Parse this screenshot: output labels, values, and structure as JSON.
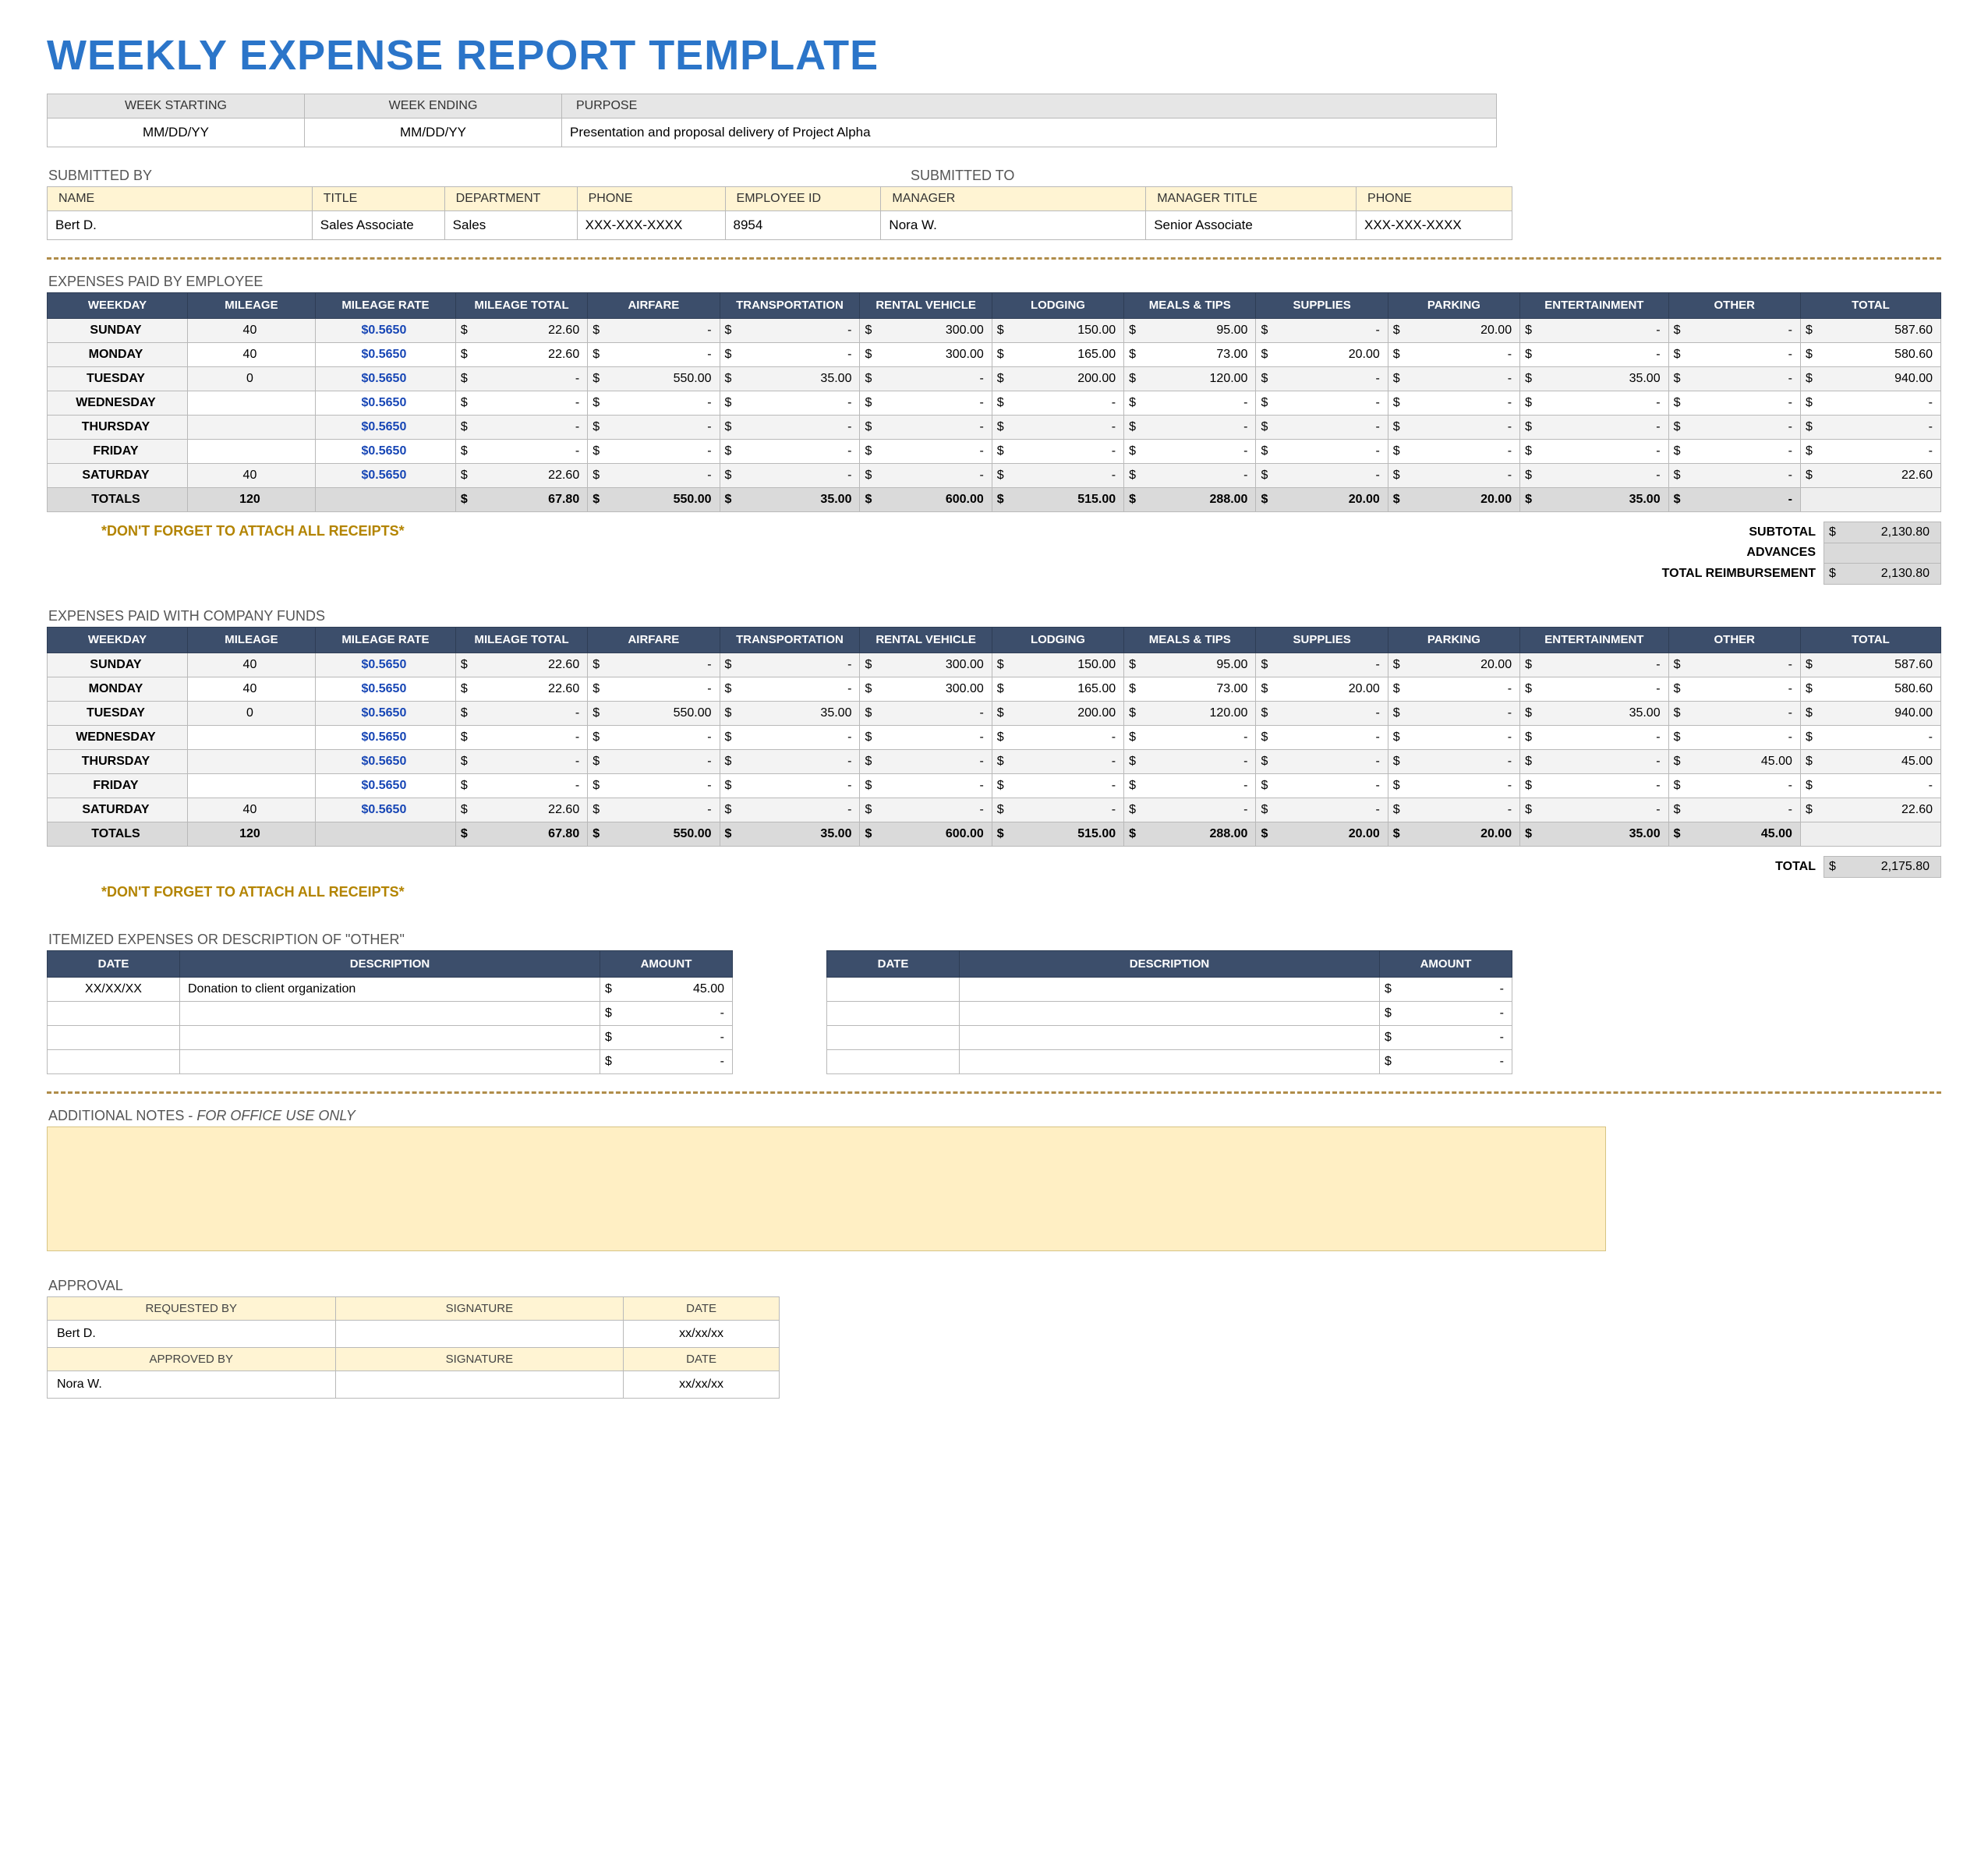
{
  "title": "WEEKLY EXPENSE REPORT TEMPLATE",
  "period": {
    "hdr_start": "WEEK STARTING",
    "hdr_end": "WEEK ENDING",
    "hdr_purpose": "PURPOSE",
    "start": "MM/DD/YY",
    "end": "MM/DD/YY",
    "purpose": "Presentation and proposal delivery of Project Alpha"
  },
  "submit": {
    "by_label": "SUBMITTED BY",
    "to_label": "SUBMITTED TO",
    "hdr_name": "NAME",
    "hdr_title": "TITLE",
    "hdr_dept": "DEPARTMENT",
    "hdr_phone": "PHONE",
    "hdr_emp": "EMPLOYEE ID",
    "hdr_mgr": "MANAGER",
    "hdr_mgt": "MANAGER TITLE",
    "name": "Bert D.",
    "title": "Sales Associate",
    "dept": "Sales",
    "phone": "XXX-XXX-XXXX",
    "emp": "8954",
    "mgr": "Nora W.",
    "mgt": "Senior Associate",
    "mgp": "XXX-XXX-XXXX"
  },
  "exp_hdr": {
    "weekday": "WEEKDAY",
    "mileage": "MILEAGE",
    "rate": "MILEAGE RATE",
    "mtotal": "MILEAGE TOTAL",
    "air": "AIRFARE",
    "trans": "TRANSPORTATION",
    "rental": "RENTAL VEHICLE",
    "lodging": "LODGING",
    "meals": "MEALS & TIPS",
    "supplies": "SUPPLIES",
    "parking": "PARKING",
    "ent": "ENTERTAINMENT",
    "other": "OTHER",
    "total": "TOTAL",
    "totals_lbl": "TOTALS"
  },
  "section_employee": "EXPENSES PAID BY EMPLOYEE",
  "section_company": "EXPENSES PAID WITH COMPANY FUNDS",
  "rate_str": "$0.5650",
  "employee_rows": [
    {
      "day": "SUNDAY",
      "mile": "40",
      "mtot": "22.60",
      "air": "-",
      "trans": "-",
      "rent": "300.00",
      "lod": "150.00",
      "meal": "95.00",
      "sup": "-",
      "park": "20.00",
      "ent": "-",
      "oth": "-",
      "tot": "587.60"
    },
    {
      "day": "MONDAY",
      "mile": "40",
      "mtot": "22.60",
      "air": "-",
      "trans": "-",
      "rent": "300.00",
      "lod": "165.00",
      "meal": "73.00",
      "sup": "20.00",
      "park": "-",
      "ent": "-",
      "oth": "-",
      "tot": "580.60"
    },
    {
      "day": "TUESDAY",
      "mile": "0",
      "mtot": "-",
      "air": "550.00",
      "trans": "35.00",
      "rent": "-",
      "lod": "200.00",
      "meal": "120.00",
      "sup": "-",
      "park": "-",
      "ent": "35.00",
      "oth": "-",
      "tot": "940.00"
    },
    {
      "day": "WEDNESDAY",
      "mile": "",
      "mtot": "-",
      "air": "-",
      "trans": "-",
      "rent": "-",
      "lod": "-",
      "meal": "-",
      "sup": "-",
      "park": "-",
      "ent": "-",
      "oth": "-",
      "tot": "-"
    },
    {
      "day": "THURSDAY",
      "mile": "",
      "mtot": "-",
      "air": "-",
      "trans": "-",
      "rent": "-",
      "lod": "-",
      "meal": "-",
      "sup": "-",
      "park": "-",
      "ent": "-",
      "oth": "-",
      "tot": "-"
    },
    {
      "day": "FRIDAY",
      "mile": "",
      "mtot": "-",
      "air": "-",
      "trans": "-",
      "rent": "-",
      "lod": "-",
      "meal": "-",
      "sup": "-",
      "park": "-",
      "ent": "-",
      "oth": "-",
      "tot": "-"
    },
    {
      "day": "SATURDAY",
      "mile": "40",
      "mtot": "22.60",
      "air": "-",
      "trans": "-",
      "rent": "-",
      "lod": "-",
      "meal": "-",
      "sup": "-",
      "park": "-",
      "ent": "-",
      "oth": "-",
      "tot": "22.60"
    }
  ],
  "employee_totals": {
    "mile": "120",
    "mtot": "67.80",
    "air": "550.00",
    "trans": "35.00",
    "rent": "600.00",
    "lod": "515.00",
    "meal": "288.00",
    "sup": "20.00",
    "park": "20.00",
    "ent": "35.00",
    "oth": "-",
    "tot": ""
  },
  "sub_employee": {
    "subtotal_lbl": "SUBTOTAL",
    "subtotal": "2,130.80",
    "adv_lbl": "ADVANCES",
    "adv": "",
    "reimb_lbl": "TOTAL REIMBURSEMENT",
    "reimb": "2,130.80"
  },
  "company_rows": [
    {
      "day": "SUNDAY",
      "mile": "40",
      "mtot": "22.60",
      "air": "-",
      "trans": "-",
      "rent": "300.00",
      "lod": "150.00",
      "meal": "95.00",
      "sup": "-",
      "park": "20.00",
      "ent": "-",
      "oth": "-",
      "tot": "587.60"
    },
    {
      "day": "MONDAY",
      "mile": "40",
      "mtot": "22.60",
      "air": "-",
      "trans": "-",
      "rent": "300.00",
      "lod": "165.00",
      "meal": "73.00",
      "sup": "20.00",
      "park": "-",
      "ent": "-",
      "oth": "-",
      "tot": "580.60"
    },
    {
      "day": "TUESDAY",
      "mile": "0",
      "mtot": "-",
      "air": "550.00",
      "trans": "35.00",
      "rent": "-",
      "lod": "200.00",
      "meal": "120.00",
      "sup": "-",
      "park": "-",
      "ent": "35.00",
      "oth": "-",
      "tot": "940.00"
    },
    {
      "day": "WEDNESDAY",
      "mile": "",
      "mtot": "-",
      "air": "-",
      "trans": "-",
      "rent": "-",
      "lod": "-",
      "meal": "-",
      "sup": "-",
      "park": "-",
      "ent": "-",
      "oth": "-",
      "tot": "-"
    },
    {
      "day": "THURSDAY",
      "mile": "",
      "mtot": "-",
      "air": "-",
      "trans": "-",
      "rent": "-",
      "lod": "-",
      "meal": "-",
      "sup": "-",
      "park": "-",
      "ent": "-",
      "oth": "45.00",
      "tot": "45.00"
    },
    {
      "day": "FRIDAY",
      "mile": "",
      "mtot": "-",
      "air": "-",
      "trans": "-",
      "rent": "-",
      "lod": "-",
      "meal": "-",
      "sup": "-",
      "park": "-",
      "ent": "-",
      "oth": "-",
      "tot": "-"
    },
    {
      "day": "SATURDAY",
      "mile": "40",
      "mtot": "22.60",
      "air": "-",
      "trans": "-",
      "rent": "-",
      "lod": "-",
      "meal": "-",
      "sup": "-",
      "park": "-",
      "ent": "-",
      "oth": "-",
      "tot": "22.60"
    }
  ],
  "company_totals": {
    "mile": "120",
    "mtot": "67.80",
    "air": "550.00",
    "trans": "35.00",
    "rent": "600.00",
    "lod": "515.00",
    "meal": "288.00",
    "sup": "20.00",
    "park": "20.00",
    "ent": "35.00",
    "oth": "45.00",
    "tot": ""
  },
  "sub_company": {
    "total_lbl": "TOTAL",
    "total": "2,175.80"
  },
  "receipts_note": "*DON'T FORGET TO ATTACH ALL RECEIPTS*",
  "itemized": {
    "section": "ITEMIZED EXPENSES OR DESCRIPTION OF \"OTHER\"",
    "hdr_date": "DATE",
    "hdr_desc": "DESCRIPTION",
    "hdr_amount": "AMOUNT",
    "left": [
      {
        "date": "XX/XX/XX",
        "desc": "Donation to client organization",
        "amt": "45.00"
      },
      {
        "date": "",
        "desc": "",
        "amt": "-"
      },
      {
        "date": "",
        "desc": "",
        "amt": "-"
      },
      {
        "date": "",
        "desc": "",
        "amt": "-"
      }
    ],
    "right": [
      {
        "date": "",
        "desc": "",
        "amt": "-"
      },
      {
        "date": "",
        "desc": "",
        "amt": "-"
      },
      {
        "date": "",
        "desc": "",
        "amt": "-"
      },
      {
        "date": "",
        "desc": "",
        "amt": "-"
      }
    ]
  },
  "notes": {
    "section_a": "ADDITIONAL NOTES - ",
    "section_b": "FOR OFFICE USE ONLY"
  },
  "approval": {
    "section": "APPROVAL",
    "hdr_req": "REQUESTED BY",
    "hdr_sig": "SIGNATURE",
    "hdr_date": "DATE",
    "hdr_app": "APPROVED BY",
    "req_name": "Bert D.",
    "req_date": "xx/xx/xx",
    "app_name": "Nora W.",
    "app_date": "xx/xx/xx"
  }
}
